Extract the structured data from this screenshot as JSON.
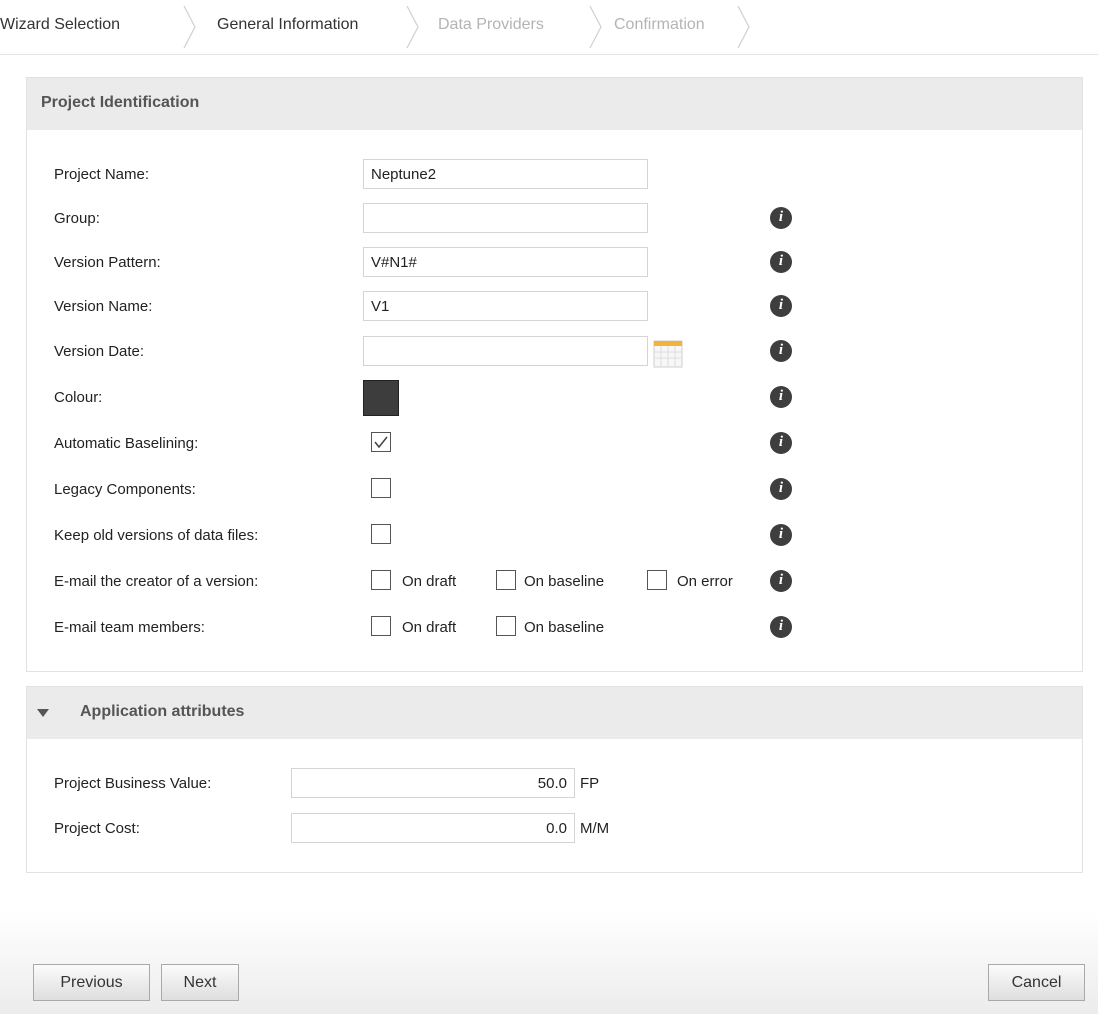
{
  "breadcrumb": {
    "steps": [
      "Wizard Selection",
      "General Information",
      "Data Providers",
      "Confirmation"
    ]
  },
  "project_identification": {
    "title": "Project Identification",
    "fields": {
      "project_name": {
        "label": "Project Name:",
        "value": "Neptune2"
      },
      "group": {
        "label": "Group:",
        "value": ""
      },
      "version_pattern": {
        "label": "Version Pattern:",
        "value": "V#N1#"
      },
      "version_name": {
        "label": "Version Name:",
        "value": "V1"
      },
      "version_date": {
        "label": "Version Date:",
        "value": ""
      },
      "colour": {
        "label": "Colour:",
        "value": "#3d3d3d"
      },
      "automatic_baselining": {
        "label": "Automatic Baselining:",
        "checked": true
      },
      "legacy_components": {
        "label": "Legacy Components:",
        "checked": false
      },
      "keep_old_versions": {
        "label": "Keep old versions of data files:",
        "checked": false
      },
      "email_creator": {
        "label": "E-mail the creator of a version:",
        "options": [
          {
            "label": "On draft",
            "checked": false
          },
          {
            "label": "On baseline",
            "checked": false
          },
          {
            "label": "On error",
            "checked": false
          }
        ]
      },
      "email_team": {
        "label": "E-mail team members:",
        "options": [
          {
            "label": "On draft",
            "checked": false
          },
          {
            "label": "On baseline",
            "checked": false
          }
        ]
      }
    }
  },
  "application_attributes": {
    "title": "Application attributes",
    "expanded": true,
    "fields": {
      "business_value": {
        "label": "Project Business Value:",
        "value": "50.0",
        "unit": "FP"
      },
      "project_cost": {
        "label": "Project Cost:",
        "value": "0.0",
        "unit": "M/M"
      }
    }
  },
  "footer": {
    "previous": "Previous",
    "next": "Next",
    "cancel": "Cancel"
  },
  "icons": [
    "info-icon",
    "calendar-icon",
    "checkmark-icon",
    "collapse-arrow-icon",
    "chevron-right-icon"
  ],
  "colors": {
    "panel_header": "#ebebeb",
    "info_icon": "#3e3e3e",
    "inactive_step": "#b4b4b4"
  }
}
